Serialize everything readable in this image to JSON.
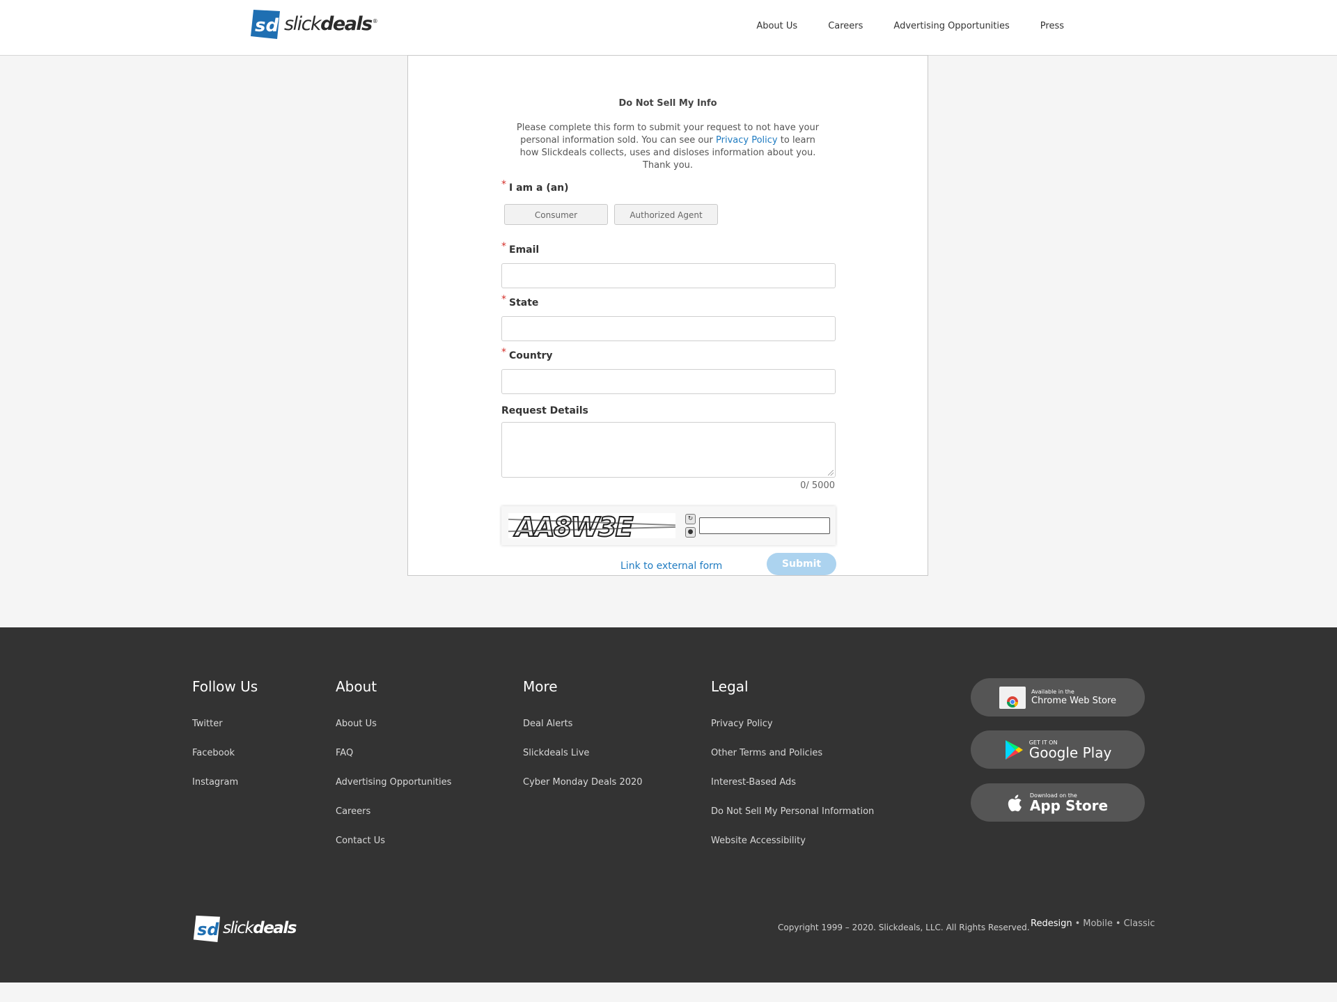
{
  "header": {
    "logo_text_light": "slick",
    "logo_text_bold": "deals",
    "nav": [
      "About Us",
      "Careers",
      "Advertising Opportunities",
      "Press"
    ]
  },
  "form": {
    "title": "Do Not Sell My Info",
    "intro_before": "Please complete this form to submit your request to not have your personal information sold. You can see our ",
    "intro_link": "Privacy Policy",
    "intro_after": " to learn how Slickdeals collects, uses and disloses information about you. Thank you.",
    "required_mark": "*",
    "iam_label": "I am a (an)",
    "options": [
      "Consumer",
      "Authorized Agent"
    ],
    "email_label": "Email",
    "state_label": "State",
    "country_label": "Country",
    "details_label": "Request Details",
    "counter": "0/ 5000",
    "captcha_text": "AA8W3E",
    "external_link": "Link to external form",
    "submit": "Submit"
  },
  "footer": {
    "columns": [
      {
        "title": "Follow Us",
        "links": [
          "Twitter",
          "Facebook",
          "Instagram"
        ]
      },
      {
        "title": "About",
        "links": [
          "About Us",
          "FAQ",
          "Advertising Opportunities",
          "Careers",
          "Contact Us"
        ]
      },
      {
        "title": "More",
        "links": [
          "Deal Alerts",
          "Slickdeals Live",
          "Cyber Monday Deals 2020"
        ]
      },
      {
        "title": "Legal",
        "links": [
          "Privacy Policy",
          "Other Terms and Policies",
          "Interest-Based Ads",
          "Do Not Sell My Personal Information",
          "Website Accessibility"
        ]
      }
    ],
    "stores": {
      "chrome_small": "Available in the",
      "chrome_big": "Chrome Web Store",
      "google_small": "GET IT ON",
      "google_big": "Google Play",
      "apple_small": "Download on the",
      "apple_big": "App Store"
    },
    "copyright": "Copyright 1999 – 2020. Slickdeals, LLC. All Rights Reserved.",
    "views": [
      "Redesign",
      "Mobile",
      "Classic"
    ],
    "view_separator": "•",
    "colors": {
      "background": "#333333",
      "link": "#d8d8d8"
    }
  },
  "colors": {
    "brand_blue": "#1f7bc1",
    "submit_disabled": "#acd3ef",
    "required": "#d4312b"
  }
}
